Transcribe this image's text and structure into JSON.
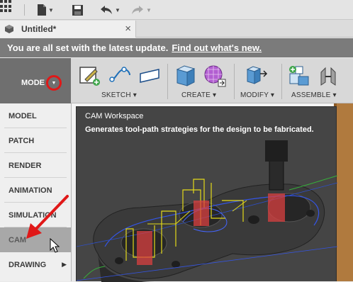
{
  "topbar": {
    "icons": [
      "data-panel-icon",
      "file-icon",
      "save-icon",
      "undo-icon",
      "redo-icon"
    ]
  },
  "tab": {
    "title": "Untitled*",
    "close": "×"
  },
  "banner": {
    "message": "You are all set with the latest update.",
    "link": "Find out what's new."
  },
  "ribbon": {
    "mode_label": "MODE",
    "groups": [
      "SKETCH ▾",
      "CREATE ▾",
      "MODIFY ▾",
      "ASSEMBLE ▾"
    ]
  },
  "mode_menu": {
    "items": [
      "MODEL",
      "PATCH",
      "RENDER",
      "ANIMATION",
      "SIMULATION",
      "CAM",
      "DRAWING"
    ],
    "active": "CAM"
  },
  "tooltip": {
    "title": "CAM Workspace",
    "description": "Generates tool-path strategies for the design to be fabricated."
  },
  "colors": {
    "annotation_red": "#e01818",
    "ribbon_mode_bg": "#6f6f6f",
    "banner_bg": "#7b7b7b",
    "tooltip_bg": "#454545"
  }
}
